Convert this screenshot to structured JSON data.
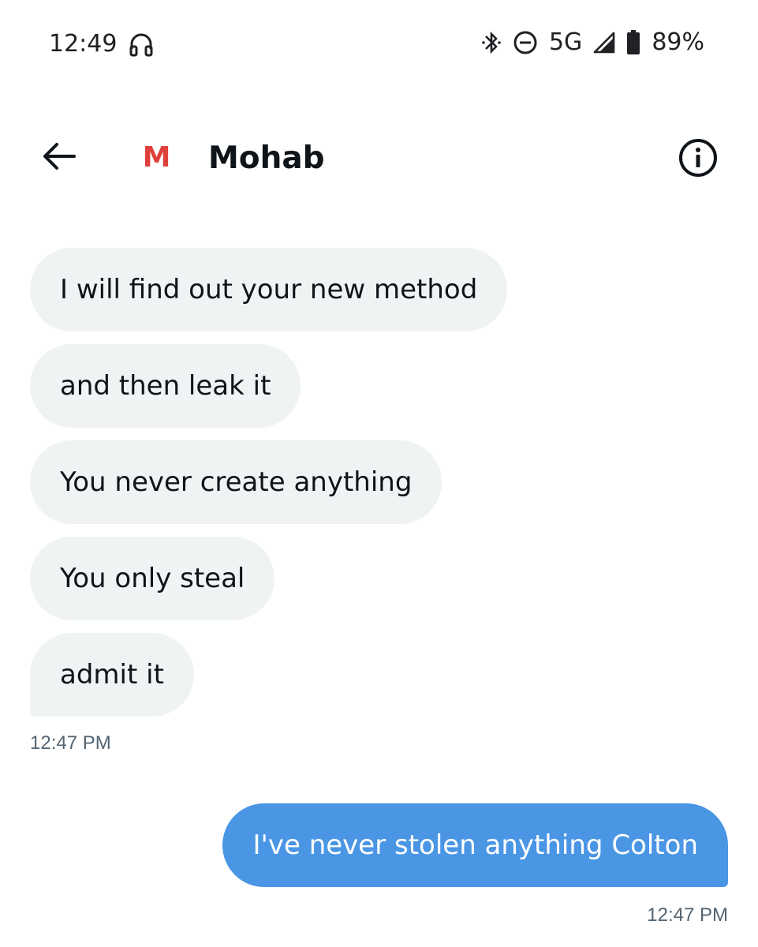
{
  "status_bar": {
    "time": "12:49",
    "network": "5G",
    "battery": "89%",
    "icons": [
      "headphones-icon",
      "bluetooth-icon",
      "do-not-disturb-icon",
      "signal-icon",
      "battery-icon"
    ]
  },
  "header": {
    "avatar_letter": "M",
    "contact_name": "Mohab",
    "back_icon": "back-arrow-icon",
    "info_icon": "info-icon"
  },
  "messages": {
    "incoming": [
      {
        "text": "I will find out your new method"
      },
      {
        "text": "and then leak it"
      },
      {
        "text": "You never create anything"
      },
      {
        "text": "You only steal"
      },
      {
        "text": "admit it"
      }
    ],
    "incoming_time": "12:47 PM",
    "outgoing": [
      {
        "text": "I've never stolen anything Colton"
      }
    ],
    "outgoing_time": "12:47 PM"
  },
  "colors": {
    "incoming_bubble": "#eff3f4",
    "outgoing_bubble": "#4a96e5",
    "avatar_accent": "#e0403a",
    "timestamp": "#536471"
  }
}
